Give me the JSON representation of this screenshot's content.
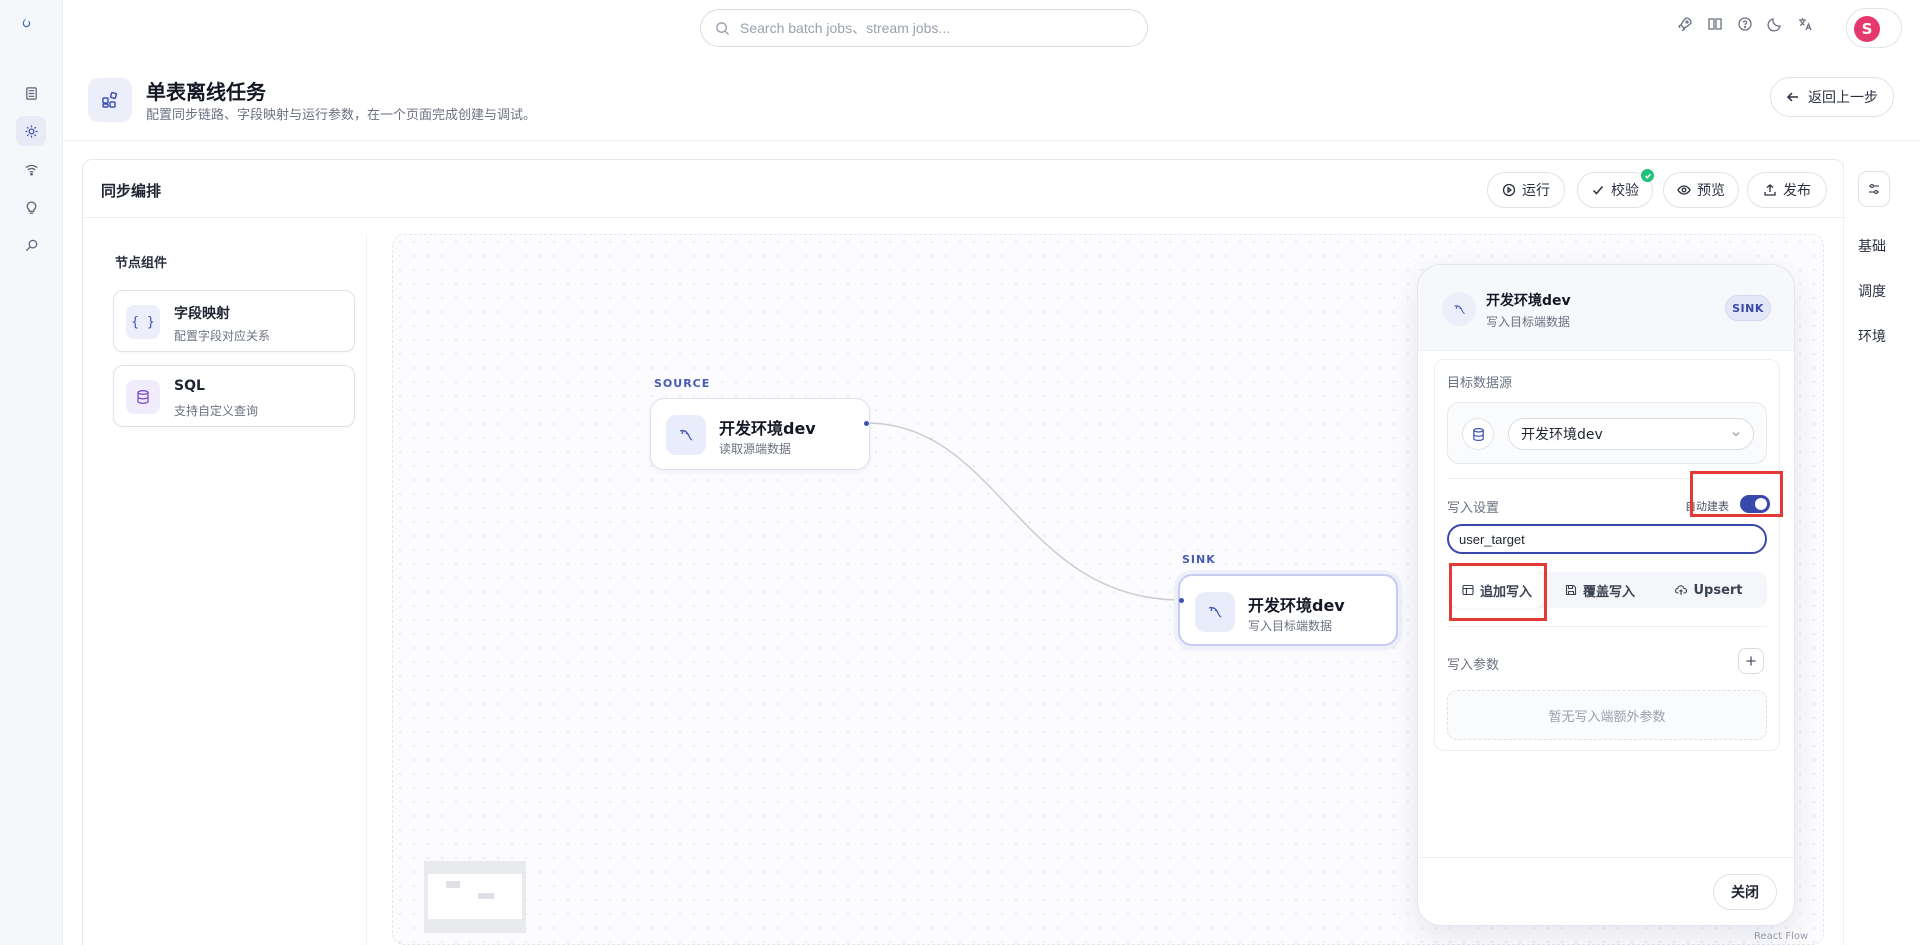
{
  "search": {
    "placeholder": "Search batch jobs、stream jobs..."
  },
  "header": {
    "title": "单表离线任务",
    "subtitle": "配置同步链路、字段映射与运行参数，在一个页面完成创建与调试。",
    "back_label": "返回上一步"
  },
  "user": {
    "initial": "S",
    "avatar_color": "#e5396d"
  },
  "card": {
    "title": "同步编排"
  },
  "toolbar": {
    "run": "运行",
    "validate": "校验",
    "preview": "预览",
    "publish": "发布"
  },
  "right_tabs": [
    "基础",
    "调度",
    "环境"
  ],
  "palette": {
    "title": "节点组件",
    "items": [
      {
        "name": "字段映射",
        "desc": "配置字段对应关系",
        "icon": "{ }"
      },
      {
        "name": "SQL",
        "desc": "支持自定义查询",
        "icon": "database-icon"
      }
    ]
  },
  "flow": {
    "source": {
      "tag": "SOURCE",
      "title": "开发环境dev",
      "subtitle": "读取源端数据"
    },
    "sink": {
      "tag": "SINK",
      "title": "开发环境dev",
      "subtitle": "写入目标端数据"
    },
    "attribution": "React Flow"
  },
  "drawer": {
    "title": "开发环境dev",
    "subtitle": "写入目标端数据",
    "badge": "SINK",
    "target_source_label": "目标数据源",
    "target_source_value": "开发环境dev",
    "write_settings_label": "写入设置",
    "auto_create_label": "自动建表",
    "auto_create_on": true,
    "table_name": "user_target",
    "modes": [
      "追加写入",
      "覆盖写入",
      "Upsert"
    ],
    "active_mode": "追加写入",
    "params_label": "写入参数",
    "params_empty": "暂无写入端额外参数",
    "close_label": "关闭"
  },
  "colors": {
    "accent": "#3949ab",
    "highlight": "#e53935",
    "success": "#22c07a"
  }
}
